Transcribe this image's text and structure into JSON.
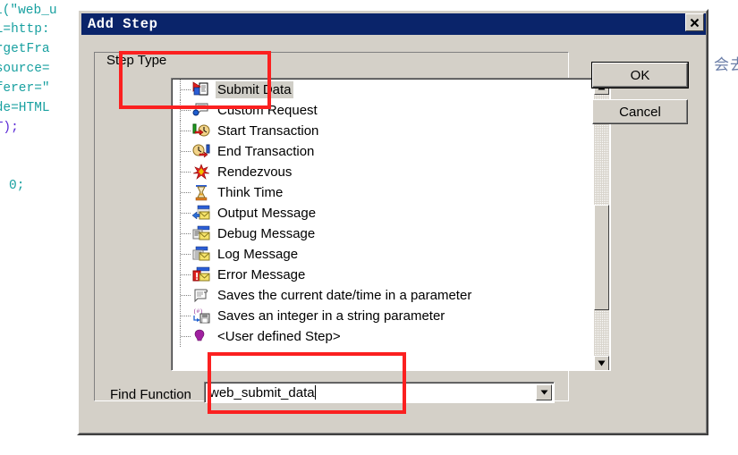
{
  "background_code": {
    "lines": [
      "l(\"web_u",
      "RL=http:",
      "argetFra",
      "esource=",
      "eferer=\"",
      "ode=HTML",
      "ST);",
      "",
      "0;"
    ],
    "cjk_fragment": "会去"
  },
  "dialog": {
    "title": "Add Step",
    "close_label": "×",
    "group_label": "Step Type",
    "buttons": {
      "ok": "OK",
      "cancel": "Cancel"
    },
    "find": {
      "label": "Find Function",
      "value": "web_submit_data",
      "placeholder": ""
    },
    "list": {
      "selected_index": 0,
      "items": [
        {
          "label": "Submit Data",
          "icon": "submit-data-icon"
        },
        {
          "label": "Custom Request",
          "icon": "custom-request-icon"
        },
        {
          "label": "Start Transaction",
          "icon": "start-transaction-icon"
        },
        {
          "label": "End Transaction",
          "icon": "end-transaction-icon"
        },
        {
          "label": "Rendezvous",
          "icon": "rendezvous-icon"
        },
        {
          "label": "Think Time",
          "icon": "think-time-icon"
        },
        {
          "label": "Output Message",
          "icon": "output-message-icon"
        },
        {
          "label": "Debug Message",
          "icon": "debug-message-icon"
        },
        {
          "label": "Log Message",
          "icon": "log-message-icon"
        },
        {
          "label": "Error Message",
          "icon": "error-message-icon"
        },
        {
          "label": "Saves the current date/time in a parameter",
          "icon": "save-datetime-icon"
        },
        {
          "label": "Saves an integer in a string parameter",
          "icon": "save-integer-icon"
        },
        {
          "label": "<User defined Step>",
          "icon": "user-defined-step-icon"
        }
      ]
    },
    "scrollbar": {
      "up_arrow": "▲",
      "down_arrow": "▼"
    }
  },
  "colors": {
    "dialog_face": "#d4d0c8",
    "titlebar": "#0a246a",
    "annotation_red": "#fb2020",
    "code_teal": "#18a0a0",
    "code_purple": "#5b2bd6"
  }
}
